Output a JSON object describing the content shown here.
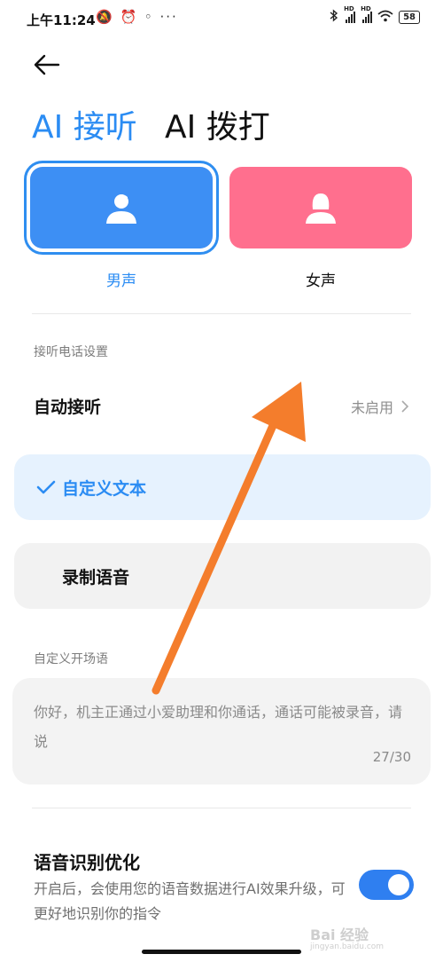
{
  "status": {
    "time": "上午11:24",
    "left_icons": "🔕 ⏰ ◦ ···",
    "battery": "58",
    "sig1_label": "HD",
    "sig2_label": "HD"
  },
  "tabs": [
    {
      "label": "AI 接听",
      "active": true
    },
    {
      "label": "AI 拨打",
      "active": false
    }
  ],
  "voices": [
    {
      "label": "男声",
      "selected": true,
      "icon": "male-user-icon",
      "color": "#3d8ff4"
    },
    {
      "label": "女声",
      "selected": false,
      "icon": "female-user-icon",
      "color": "#ff6f8e"
    }
  ],
  "answer_settings": {
    "section_title": "接听电话设置",
    "auto_answer_label": "自动接听",
    "auto_answer_value": "未启用"
  },
  "options": [
    {
      "label": "自定义文本",
      "selected": true
    },
    {
      "label": "录制语音",
      "selected": false
    }
  ],
  "greeting": {
    "section_title": "自定义开场语",
    "text": "你好，机主正通过小爱助理和你通话，通话可能被录音，请说",
    "count": "27/30"
  },
  "optimization": {
    "title": "语音识别优化",
    "description": "开启后，会使用您的语音数据进行AI效果升级，可更好地识别你的指令",
    "enabled": true
  },
  "watermark": {
    "main": "Bai 经验",
    "sub": "jingyan.baidu.com"
  },
  "colors": {
    "accent": "#2b8cf3",
    "annotation_arrow": "#f47d2c"
  }
}
